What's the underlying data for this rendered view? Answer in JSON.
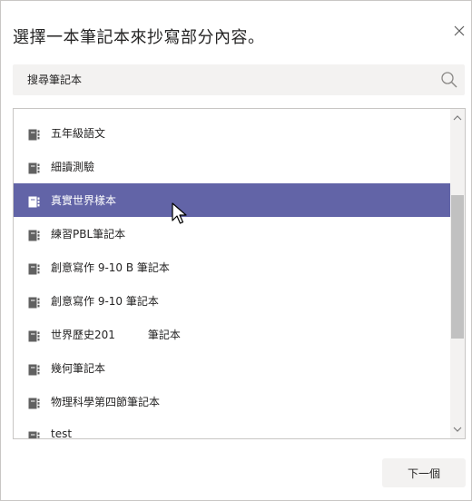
{
  "dialog": {
    "title": "選擇一本筆記本來抄寫部分內容。",
    "close_icon": "close-icon"
  },
  "search": {
    "placeholder": "搜尋筆記本",
    "icon": "search-icon"
  },
  "notebooks": [
    {
      "label": "五年級語文",
      "selected": false
    },
    {
      "label": "細讀測驗",
      "selected": false
    },
    {
      "label": "真實世界樣本",
      "selected": true
    },
    {
      "label": "練習PBL筆記本",
      "selected": false
    },
    {
      "label": "創意寫作 9-10 B 筆記本",
      "selected": false
    },
    {
      "label": "創意寫作 9-10 筆記本",
      "selected": false
    },
    {
      "label": "世界歷史201　　　筆記本",
      "selected": false
    },
    {
      "label": "幾何筆記本",
      "selected": false
    },
    {
      "label": "物理科學第四節筆記本",
      "selected": false
    },
    {
      "label": "test",
      "selected": false
    }
  ],
  "footer": {
    "next_label": "下一個"
  },
  "colors": {
    "selected_background": "#6264a7",
    "selected_text": "#ffffff",
    "icon": "#616161"
  }
}
